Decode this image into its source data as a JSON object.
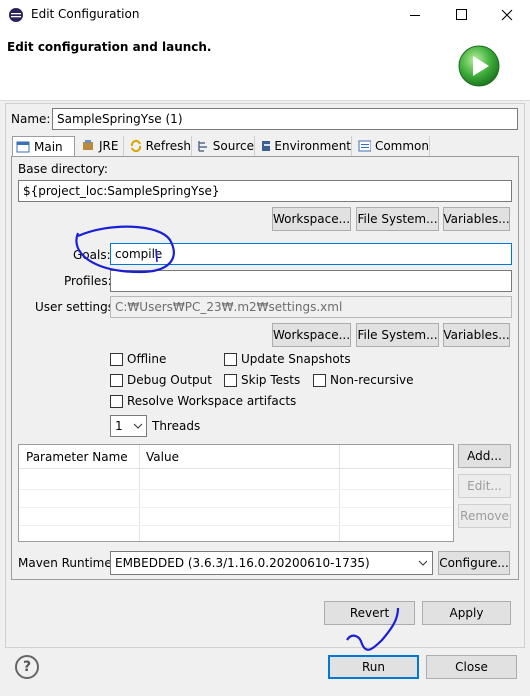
{
  "window": {
    "title": "Edit Configuration"
  },
  "banner": {
    "heading": "Edit configuration and launch."
  },
  "name": {
    "label": "Name:",
    "value": "SampleSpringYse (1)"
  },
  "tabs": [
    {
      "label": "Main",
      "icon": "main-tab-icon"
    },
    {
      "label": "JRE",
      "icon": "jre-icon"
    },
    {
      "label": "Refresh",
      "icon": "refresh-icon"
    },
    {
      "label": "Source",
      "icon": "source-icon"
    },
    {
      "label": "Environment",
      "icon": "environment-icon"
    },
    {
      "label": "Common",
      "icon": "common-icon"
    }
  ],
  "main": {
    "base_dir_label": "Base directory:",
    "base_dir_value": "${project_loc:SampleSpringYse}",
    "workspace_label": "Workspace...",
    "filesystem_label": "File System...",
    "variables_label": "Variables...",
    "goals_label": "Goals:",
    "goals_value": "compile",
    "profiles_label": "Profiles:",
    "profiles_value": "",
    "user_settings_label": "User settings:",
    "user_settings_value": "C:₩Users₩PC_23₩.m2₩settings.xml",
    "checkboxes": {
      "offline": "Offline",
      "update_snapshots": "Update Snapshots",
      "debug_output": "Debug Output",
      "skip_tests": "Skip Tests",
      "non_recursive": "Non-recursive",
      "resolve_workspace": "Resolve Workspace artifacts"
    },
    "threads_value": "1",
    "threads_label": "Threads",
    "param_headers": [
      "Parameter Name",
      "Value"
    ],
    "add_label": "Add...",
    "edit_label": "Edit...",
    "remove_label": "Remove",
    "runtime_label": "Maven Runtime:",
    "runtime_value": "EMBEDDED (3.6.3/1.16.0.20200610-1735)",
    "configure_label": "Configure..."
  },
  "footer": {
    "revert_label": "Revert",
    "apply_label": "Apply",
    "run_label": "Run",
    "close_label": "Close",
    "help_symbol": "?"
  },
  "colors": {
    "accent": "#0078d7",
    "annotation": "#1a20d6",
    "run_green": "#3aaa35"
  }
}
